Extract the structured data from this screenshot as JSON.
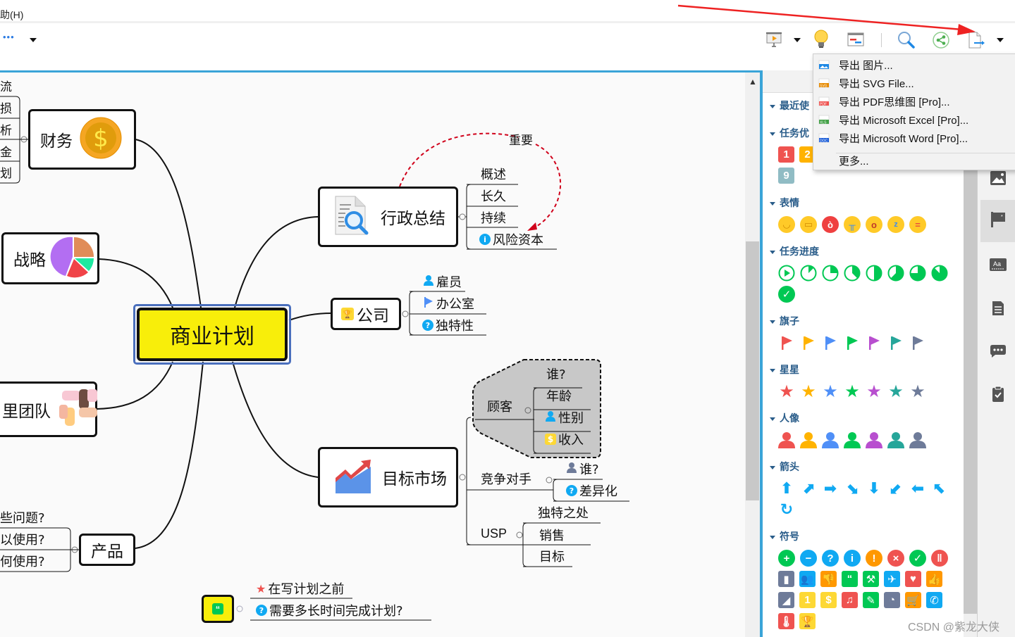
{
  "menubar": {
    "help_menu": "助(H)"
  },
  "toolbar": {
    "more_dots": "•••",
    "buttons": [
      "presentation-icon",
      "lightbulb-icon",
      "gantt-icon",
      "search-icon",
      "share-icon",
      "export-icon"
    ]
  },
  "export_menu": {
    "items": [
      {
        "label": "导出 图片...",
        "icon": "image-file-icon",
        "badge": ""
      },
      {
        "label": "导出 SVG File...",
        "icon": "svg-file-icon",
        "badge": "SVG"
      },
      {
        "label": "导出 PDF思维图 [Pro]...",
        "icon": "pdf-file-icon",
        "badge": "PDF"
      },
      {
        "label": "导出 Microsoft Excel [Pro]...",
        "icon": "xls-file-icon",
        "badge": "XLS"
      },
      {
        "label": "导出 Microsoft Word [Pro]...",
        "icon": "doc-file-icon",
        "badge": "DOC"
      }
    ],
    "more": "更多..."
  },
  "panel": {
    "sections": {
      "recent": "最近使",
      "priority": "任务优",
      "emotion": "表情",
      "progress": "任务进度",
      "flags": "旗子",
      "stars": "星星",
      "people": "人像",
      "arrows": "箭头",
      "symbols": "符号"
    },
    "priority_badges": [
      "1",
      "2",
      "9"
    ],
    "colors": {
      "red": "#ef5350",
      "orange": "#ffb300",
      "blue": "#4f8ff7",
      "green": "#00c853",
      "purple": "#b84fcf",
      "teal": "#26a69a",
      "gray": "#6e7b99",
      "cyan": "#10a9f2"
    }
  },
  "mindmap": {
    "central": "商业计划",
    "finance": {
      "label": "财务",
      "left_items": [
        "流",
        "损",
        "析",
        "金",
        "划"
      ]
    },
    "strategy": {
      "label": "战略"
    },
    "team": {
      "label": "里团队"
    },
    "product": {
      "label": "产品",
      "items": [
        "些问题?",
        "以使用?",
        "何使用?"
      ]
    },
    "admin": {
      "label": "行政总结",
      "items": [
        "概述",
        "长久",
        "持续",
        "风险资本"
      ],
      "relation_label": "重要"
    },
    "company": {
      "label": "公司",
      "items": [
        "雇员",
        "办公室",
        "独特性"
      ]
    },
    "market": {
      "label": "目标市场",
      "customer": {
        "label": "顾客",
        "items": [
          "谁?",
          "年龄",
          "性别",
          "收入"
        ]
      },
      "competitor": {
        "label": "竞争对手",
        "items": [
          "谁?",
          "差异化"
        ]
      },
      "usp": {
        "label": "USP",
        "items": [
          "独特之处",
          "销售",
          "目标"
        ]
      }
    },
    "note": {
      "items": [
        "在写计划之前",
        "需要多长时间完成计划?"
      ]
    }
  },
  "watermark": "CSDN @紫龙大侠"
}
